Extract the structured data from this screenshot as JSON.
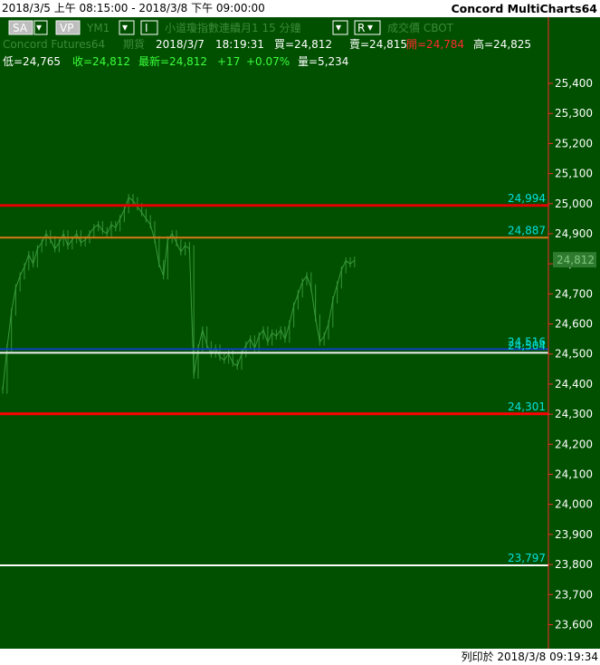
{
  "window": {
    "date_range": "2018/3/5 上午 08:15:00 - 2018/3/8 下午 09:00:00",
    "app_name": "Concord MultiCharts64"
  },
  "toolbar": {
    "sa_label": "SA",
    "vp_label": "VP",
    "symbol": "YM1",
    "interval_label": "I",
    "symbol_desc": "小道瓊指數連續月1 15 分鐘",
    "r_label": "R",
    "price_type": "成交價 CBOT",
    "dropdown_arrow": "▾"
  },
  "quote": {
    "feed": "Concord Futures64",
    "market": "期貨",
    "date": "2018/3/7",
    "time": "18:19:31",
    "bid": "買=24,812",
    "ask": "賣=24,815",
    "open": "開=24,784",
    "high": "高=24,825",
    "low": "低=24,765",
    "close": "收=24,812",
    "last": "最新=24,812",
    "change": "+17",
    "change_pct": "+0.07%",
    "volume": "量=5,234"
  },
  "colors": {
    "background": "#005000",
    "text_white": "#ffffff",
    "text_green": "#3cff3c",
    "text_red": "#ff2a2a",
    "level_label": "#00e0e0",
    "candles": "#2e8a2e",
    "last_price_box": "#2e7a2e",
    "axis": "#ff2a2a"
  },
  "chart_data": {
    "type": "line",
    "ylim": [
      23520,
      25620
    ],
    "ticks": [
      {
        "value": 25400,
        "label": "25,400"
      },
      {
        "value": 25300,
        "label": "25,300"
      },
      {
        "value": 25200,
        "label": "25,200"
      },
      {
        "value": 25100,
        "label": "25,100"
      },
      {
        "value": 25000,
        "label": "25,000"
      },
      {
        "value": 24900,
        "label": "24,900"
      },
      {
        "value": 24800,
        "label": "24,800"
      },
      {
        "value": 24700,
        "label": "24,700"
      },
      {
        "value": 24600,
        "label": "24,600"
      },
      {
        "value": 24500,
        "label": "24,500"
      },
      {
        "value": 24400,
        "label": "24,400"
      },
      {
        "value": 24300,
        "label": "24,300"
      },
      {
        "value": 24200,
        "label": "24,200"
      },
      {
        "value": 24100,
        "label": "24,100"
      },
      {
        "value": 24000,
        "label": "24,000"
      },
      {
        "value": 23900,
        "label": "23,900"
      },
      {
        "value": 23800,
        "label": "23,800"
      },
      {
        "value": 23700,
        "label": "23,700"
      },
      {
        "value": 23600,
        "label": "23,600"
      }
    ],
    "levels": [
      {
        "value": 24994,
        "label": "24,994",
        "color": "#e00000"
      },
      {
        "value": 24887,
        "label": "24,887",
        "color": "#d87818"
      },
      {
        "value": 24516,
        "label": "24,516",
        "color": "#1040c0"
      },
      {
        "value": 24504,
        "label": "24,504",
        "color": "#f0f0f0"
      },
      {
        "value": 24301,
        "label": "24,301",
        "color": "#ff0000"
      },
      {
        "value": 23797,
        "label": "23,797",
        "color": "#ffffff"
      }
    ],
    "last_price": {
      "value": 24812,
      "label": "24,812"
    },
    "price_series": [
      24380,
      24520,
      24640,
      24720,
      24760,
      24790,
      24830,
      24800,
      24850,
      24870,
      24900,
      24880,
      24850,
      24870,
      24900,
      24860,
      24880,
      24900,
      24870,
      24880,
      24900,
      24920,
      24930,
      24910,
      24900,
      24930,
      24920,
      24950,
      24980,
      25020,
      25010,
      24990,
      24970,
      24950,
      24930,
      24880,
      24800,
      24760,
      24880,
      24900,
      24870,
      24840,
      24860,
      24850,
      24430,
      24520,
      24580,
      24530,
      24500,
      24520,
      24490,
      24480,
      24500,
      24470,
      24460,
      24500,
      24530,
      24550,
      24520,
      24560,
      24580,
      24540,
      24570,
      24560,
      24580,
      24550,
      24600,
      24660,
      24700,
      24740,
      24760,
      24720,
      24620,
      24540,
      24560,
      24600,
      24680,
      24730,
      24780,
      24810,
      24800,
      24812
    ]
  },
  "footer": {
    "printed_at": "列印於 2018/3/8 09:19:34"
  }
}
